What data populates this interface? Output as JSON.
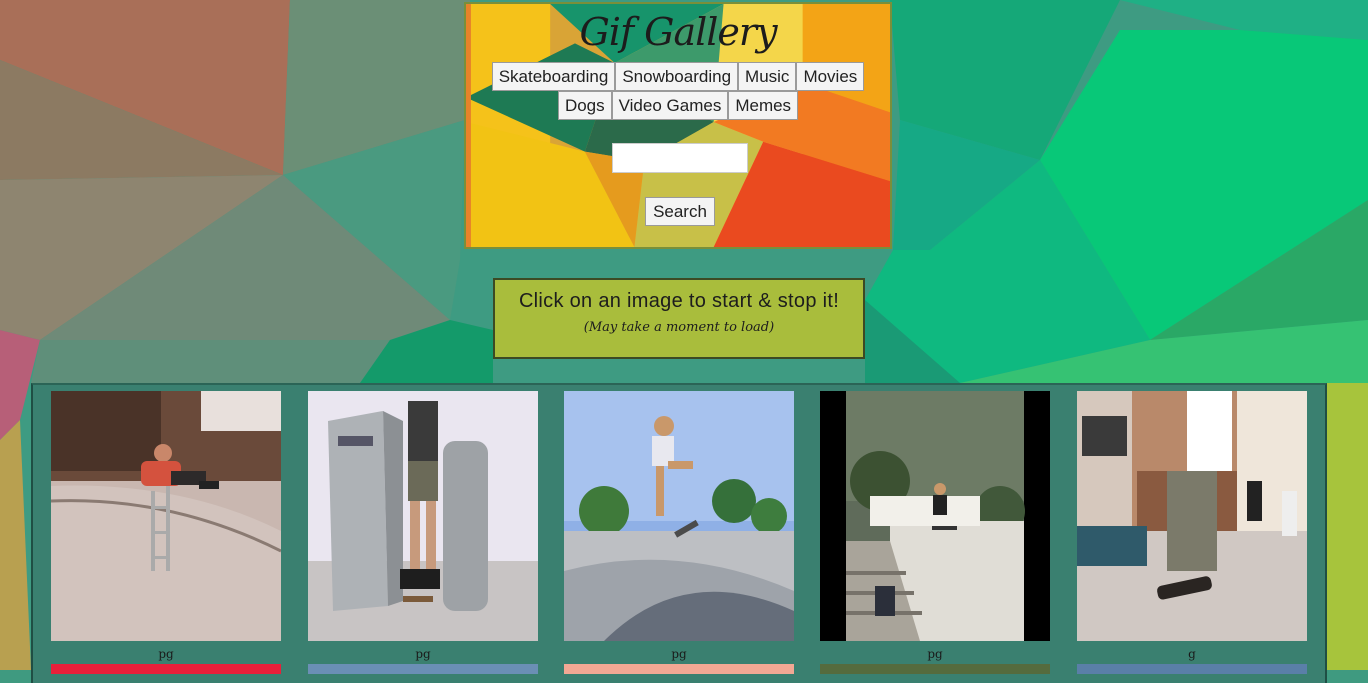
{
  "header": {
    "title": "Gif Gallery",
    "topics_row1": [
      "Skateboarding",
      "Snowboarding",
      "Music",
      "Movies"
    ],
    "topics_row2": [
      "Dogs",
      "Video Games",
      "Memes"
    ],
    "search_button": "Search",
    "search_value": ""
  },
  "notice": {
    "main": "Click on an image to start & stop it!",
    "sub": "(May take a moment to load)"
  },
  "gallery": {
    "ratings": [
      "pg",
      "pg",
      "pg",
      "pg",
      "g"
    ],
    "next_row_colors": [
      "#e8203a",
      "#6b8fb5",
      "#f2a894",
      "#556b3e",
      "#5a7fa8"
    ]
  }
}
